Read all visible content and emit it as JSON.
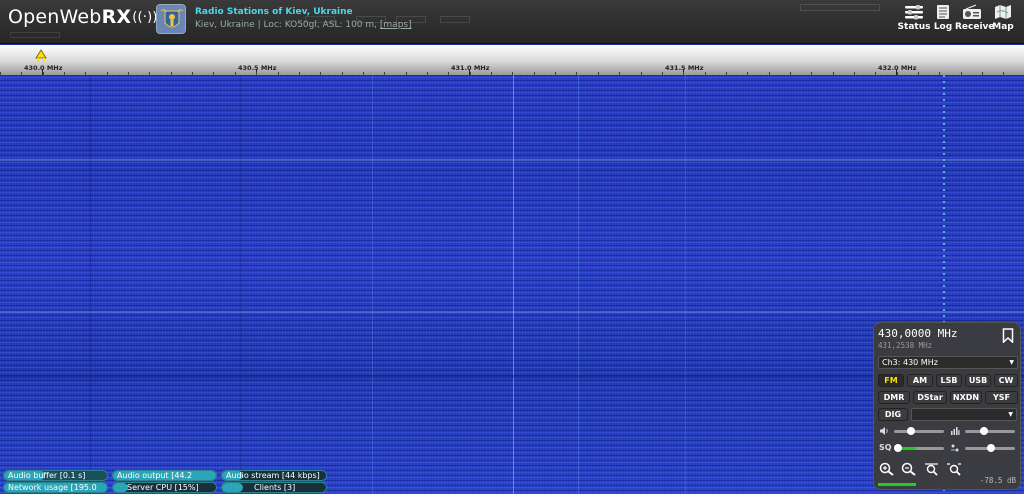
{
  "app": {
    "brand_regular": "OpenWeb",
    "brand_bold": "RX"
  },
  "receiver": {
    "title": "Radio Stations of Kiev, Ukraine",
    "location": "Kiev, Ukraine | Loc: KO50gl, ASL: 100 m,",
    "maps_link": "[maps]"
  },
  "nav": [
    {
      "label": "Status",
      "icon": "sliders-icon"
    },
    {
      "label": "Log",
      "icon": "log-icon"
    },
    {
      "label": "Receive",
      "icon": "radio-icon"
    },
    {
      "label": "Map",
      "icon": "map-icon"
    }
  ],
  "scale": {
    "labels": [
      "430.0 MHz",
      "430.5 MHz",
      "431.0 MHz",
      "431.5 MHz",
      "432.0 MHz"
    ],
    "marker_icon": "tuning-marker-icon",
    "marker_color": "#ffde00"
  },
  "status_bars": {
    "audio_buffer": "Audio buffer [0.1 s]",
    "audio_output": "Audio output [44.2",
    "audio_stream": "Audio stream [44 kbps]",
    "network_usage": "Network usage [195.0",
    "server_cpu": "Server CPU [15%]",
    "clients": "Clients [3]"
  },
  "panel": {
    "frequency": "430,0000 MHz",
    "offset_frequency": "431,2538 MHz",
    "channel_select": "Ch3: 430 MHz",
    "modes_row1": [
      "FM",
      "AM",
      "LSB",
      "USB",
      "CW"
    ],
    "modes_row2": [
      "DMR",
      "DStar",
      "NXDN",
      "YSF"
    ],
    "dig_label": "DIG",
    "active_mode": "FM",
    "smeter_db": "-78.5 dB"
  },
  "colors": {
    "accent": "#4fd6e8",
    "active_mode": "#ffde00",
    "waterfall_bg": "#2437b6",
    "status_fill": "#2aa6b8"
  }
}
